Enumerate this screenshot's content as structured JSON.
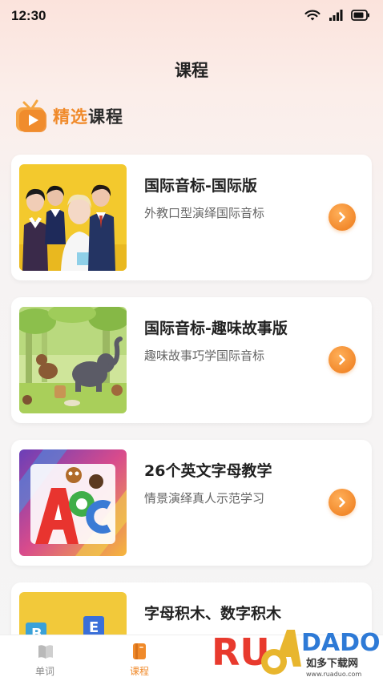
{
  "status_bar": {
    "time": "12:30"
  },
  "page": {
    "title": "课程"
  },
  "section": {
    "label_highlight": "精选",
    "label_rest": "课程"
  },
  "courses": [
    {
      "title": "国际音标-国际版",
      "subtitle": "外教口型演绎国际音标"
    },
    {
      "title": "国际音标-趣味故事版",
      "subtitle": "趣味故事巧学国际音标"
    },
    {
      "title": "26个英文字母教学",
      "subtitle": "情景演绎真人示范学习"
    },
    {
      "title": "字母积木、数字积木",
      "subtitle": ""
    }
  ],
  "tabs": [
    {
      "label": "单词",
      "color": "#8a8a8a",
      "active": false
    },
    {
      "label": "课程",
      "color": "#f08a2a",
      "active": true
    }
  ],
  "watermark": {
    "brand": "RUANDADO",
    "site_cn": "如多下载网",
    "url": "www.ruaduo.com"
  },
  "colors": {
    "accent": "#f08a2a",
    "text": "#222222",
    "subtext": "#666666"
  }
}
